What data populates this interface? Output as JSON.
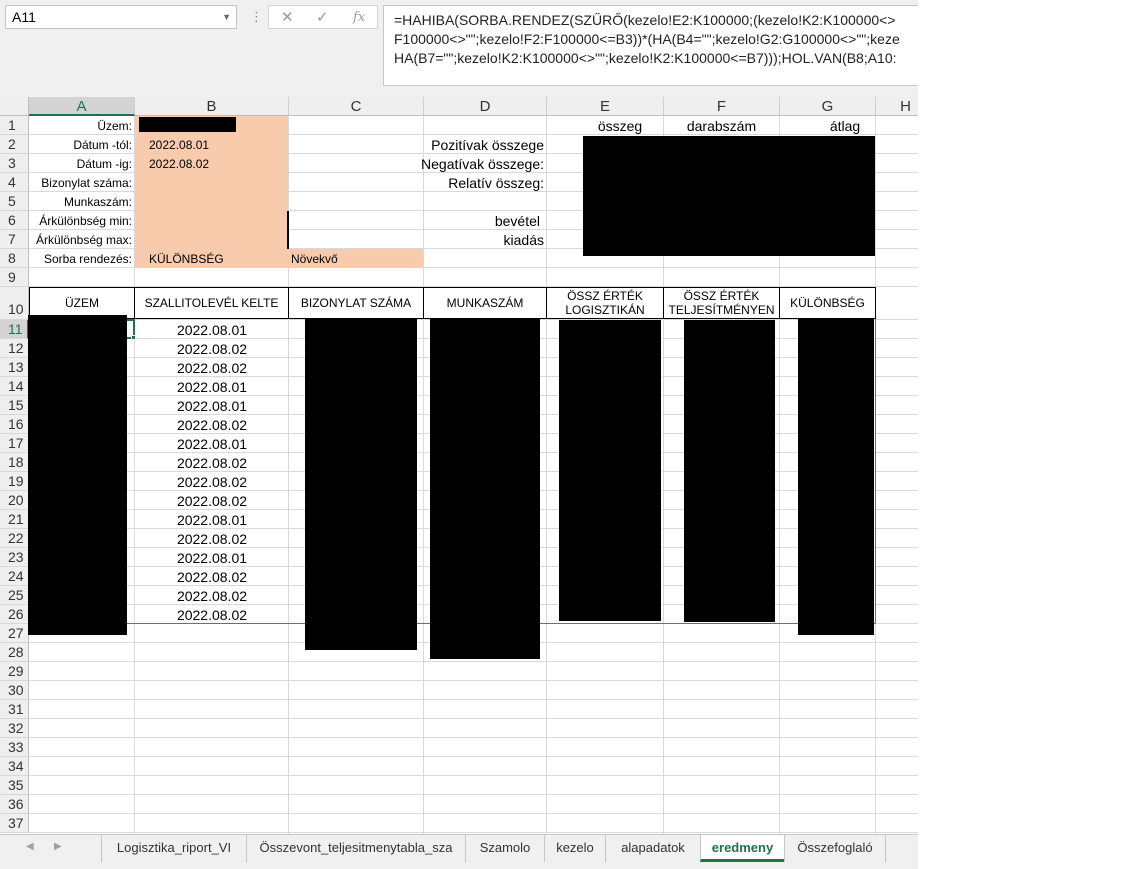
{
  "name_box": "A11",
  "fx_label": "fx",
  "formula_lines": [
    "=HAHIBA(SORBA.RENDEZ(SZŰRŐ(kezelo!E2:K100000;(kezelo!K2:K100000<>",
    "F100000<>\"\";kezelo!F2:F100000<=B3))*(HA(B4=\"\";kezelo!G2:G100000<>\"\";keze",
    "HA(B7=\"\";kezelo!K2:K100000<>\"\";kezelo!K2:K100000<=B7)));HOL.VAN(B8;A10:"
  ],
  "columns": [
    "A",
    "B",
    "C",
    "D",
    "E",
    "F",
    "G",
    "H"
  ],
  "rows": [
    "1",
    "2",
    "3",
    "4",
    "5",
    "6",
    "7",
    "8",
    "9",
    "10",
    "11",
    "12",
    "13",
    "14",
    "15",
    "16",
    "17",
    "18",
    "19",
    "20",
    "21",
    "22",
    "23",
    "24",
    "25",
    "26",
    "27",
    "28",
    "29",
    "30",
    "31",
    "32",
    "33",
    "34",
    "35",
    "36",
    "37"
  ],
  "params": {
    "labels": [
      "Üzem:",
      "Dátum -tól:",
      "Dátum -ig:",
      "Bizonylat száma:",
      "Munkaszám:",
      "Árkülönbség min:",
      "Árkülönbség max:",
      "Sorba rendezés:"
    ],
    "date_from": "2022.08.01",
    "date_to": "2022.08.02",
    "sort_field": "KÜLÖNBSÉG",
    "sort_order": "Növekvő"
  },
  "summary": {
    "headers": [
      "összeg",
      "darabszám",
      "átlag"
    ],
    "labels": [
      "Pozitívak összege",
      "Negatívak összege:",
      "Relatív összeg:",
      "bevétel",
      "kiadás"
    ]
  },
  "table": {
    "headers": [
      "ÜZEM",
      "SZALLITOLEVÉL KELTE",
      "BIZONYLAT SZÁMA",
      "MUNKASZÁM",
      "ÖSSZ ÉRTÉK LOGISZTIKÁN",
      "ÖSSZ ÉRTÉK TELJESÍTMÉNYEN",
      "KÜLÖNBSÉG"
    ],
    "dates": [
      "2022.08.01",
      "2022.08.02",
      "2022.08.02",
      "2022.08.01",
      "2022.08.01",
      "2022.08.02",
      "2022.08.01",
      "2022.08.02",
      "2022.08.02",
      "2022.08.02",
      "2022.08.01",
      "2022.08.02",
      "2022.08.01",
      "2022.08.02",
      "2022.08.02",
      "2022.08.02"
    ]
  },
  "tabs": [
    "Logisztika_riport_VI",
    "Összevont_teljesitmenytabla_sza",
    "Szamolo",
    "kezelo",
    "alapadatok",
    "eredmeny",
    "Összefoglaló"
  ],
  "active_tab": "eredmeny",
  "colors": {
    "accent": "#217346",
    "input_fill": "#f8cbad",
    "redaction": "#000000"
  }
}
